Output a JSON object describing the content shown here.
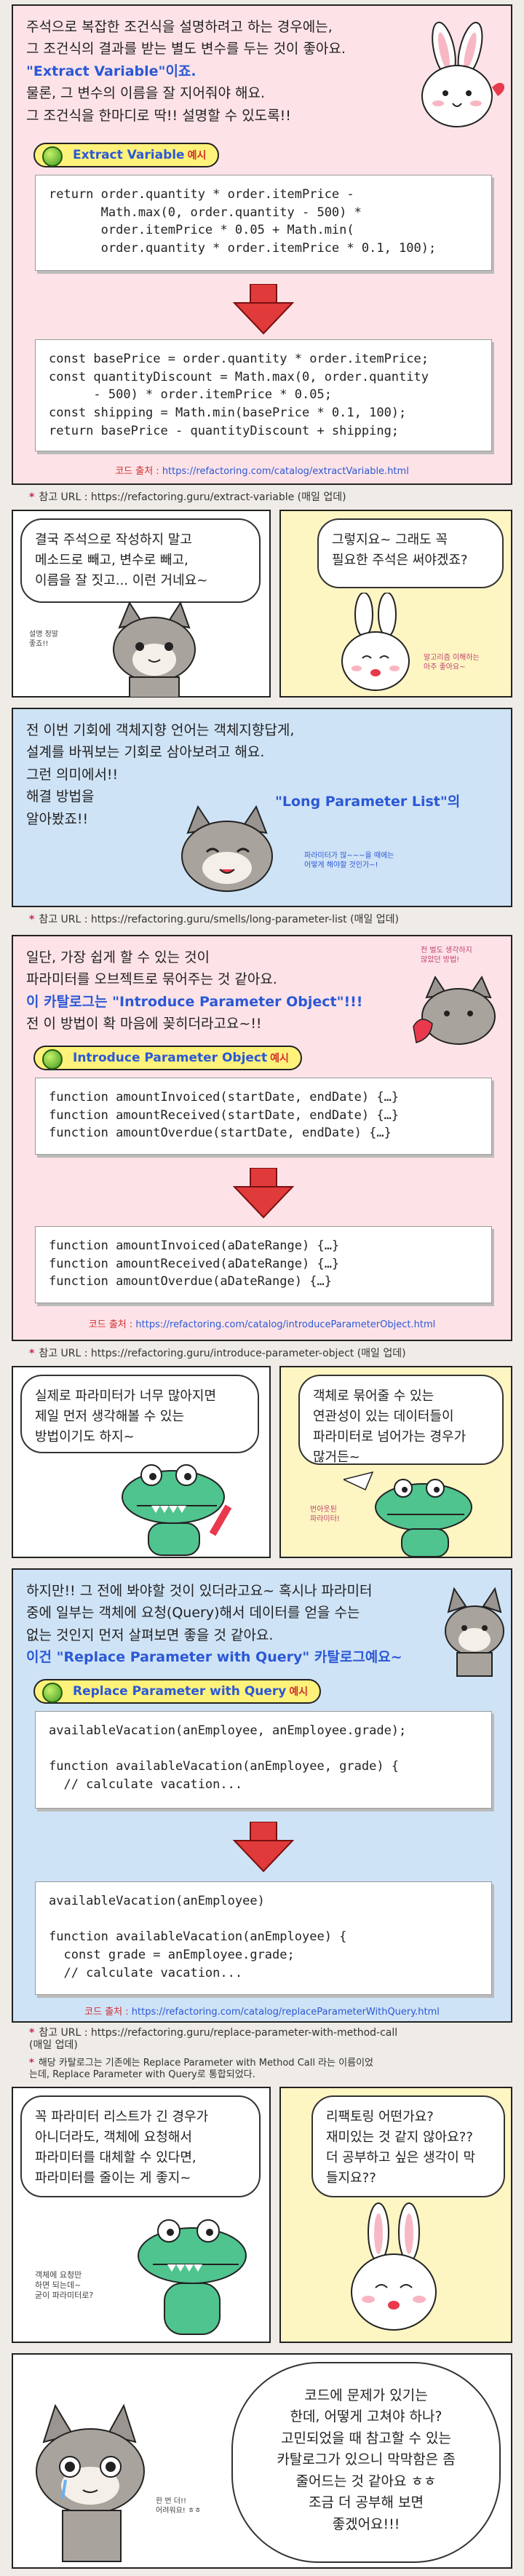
{
  "panel1": {
    "intro": [
      "주석으로 복잡한 조건식을 설명하려고 하는 경우에는,",
      "그 조건식의 결과를 받는 별도 변수를 두는 것이 좋아요.",
      "\"Extract Variable\"이죠.",
      "물론, 그 변수의 이름을 잘 지어줘야 해요.",
      "그 조건식을 한마디로 딱!! 설명할 수 있도록!!"
    ],
    "pill": "Extract Variable",
    "pill_suffix": "예시",
    "before_code": "return order.quantity * order.itemPrice -\n       Math.max(0, order.quantity - 500) *\n       order.itemPrice * 0.05 + Math.min(\n       order.quantity * order.itemPrice * 0.1, 100);",
    "after_code": "const basePrice = order.quantity * order.itemPrice;\nconst quantityDiscount = Math.max(0, order.quantity\n      - 500) * order.itemPrice * 0.05;\nconst shipping = Math.min(basePrice * 0.1, 100);\nreturn basePrice - quantityDiscount + shipping;",
    "source_label": "코드 출처 : ",
    "source_url": "https://refactoring.com/catalog/extractVariable.html"
  },
  "ref1": "참고 URL : https://refactoring.guru/extract-variable (매일 업데)",
  "panel2": {
    "left_bubble": "결국 주석으로 작성하지 말고\n메소드로 빼고, 변수로 빼고,\n이름을 잘 짓고... 이런 거네요~",
    "left_small": "설명 정말\n좋죠!!",
    "right_bubble": "그렇지요~ 그래도 꼭\n필요한 주석은 써야겠죠?",
    "right_small": "알고리즘 이해하는\n아주 좋아요~"
  },
  "panel3": {
    "lines": [
      "전 이번 기회에 객체지향 언어는 객체지향답게,",
      "설계를 바꿔보는 기회로 삼아보려고 해요.",
      "그런 의미에서!!",
      "해결 방법을",
      "알아봤죠!!"
    ],
    "highlight": "\"Long Parameter List\"의",
    "small": "파라미터가 많~~~을 때에는\n어떻게 해야할 것인가~!"
  },
  "ref2": "참고 URL : https://refactoring.guru/smells/long-parameter-list (매일 업데)",
  "panel4": {
    "lines": [
      "일단, 가장 쉽게 할 수 있는 것이",
      "파라미터를 오브젝트로 묶어주는 것 같아요.",
      "이 카탈로그는 \"Introduce Parameter Object\"!!!",
      "전 이 방법이 확 마음에 꽂히더라고요~!!"
    ],
    "small": "전 벌도 생각하지\n않았던 방법!",
    "pill": "Introduce Parameter Object",
    "pill_suffix": "예시",
    "before_code": "function amountInvoiced(startDate, endDate) {…}\nfunction amountReceived(startDate, endDate) {…}\nfunction amountOverdue(startDate, endDate) {…}",
    "after_code": "function amountInvoiced(aDateRange) {…}\nfunction amountReceived(aDateRange) {…}\nfunction amountOverdue(aDateRange) {…}",
    "source_label": "코드 출처 : ",
    "source_url": "https://refactoring.com/catalog/introduceParameterObject.html"
  },
  "ref3": "참고 URL : https://refactoring.guru/introduce-parameter-object (매일 업데)",
  "panel5": {
    "left_bubble": "실제로 파라미터가 너무 많아지면\n제일 먼저 생각해볼 수 있는\n방법이기도 하지~",
    "right_bubble": "객체로 묶어줄 수 있는\n연관성이 있는 데이터들이\n파라미터로 넘어가는 경우가\n많거든~",
    "right_small": "번아웃된\n파라미터!"
  },
  "panel6": {
    "lines": [
      "하지만!! 그 전에 봐야할 것이 있더라고요~ 혹시나 파라미터",
      "중에 일부는 객체에 요청(Query)해서 데이터를 얻을 수는",
      "없는 것인지 먼저 살펴보면 좋을 것 같아요.",
      "이건 \"Replace Parameter with Query\" 카탈로그예요~"
    ],
    "pill": "Replace Parameter with Query",
    "pill_suffix": "예시",
    "before_code": "availableVacation(anEmployee, anEmployee.grade);\n\nfunction availableVacation(anEmployee, grade) {\n  // calculate vacation...",
    "after_code": "availableVacation(anEmployee)\n\nfunction availableVacation(anEmployee) {\n  const grade = anEmployee.grade;\n  // calculate vacation...",
    "source_label": "코드 출처 : ",
    "source_url": "https://refactoring.com/catalog/replaceParameterWithQuery.html"
  },
  "ref4": "참고 URL : https://refactoring.guru/replace-parameter-with-method-call\n(매일 업데)",
  "ref5": "해당 카탈로그는 기존에는 Replace Parameter with Method Call 라는 이름이었\n는데, Replace Parameter with Query로 통합되었다.",
  "panel7": {
    "left_bubble": "꼭 파라미터 리스트가 긴 경우가\n아니더라도, 객체에 요청해서\n파라미터를 대체할 수 있다면,\n파라미터를 줄이는 게 좋지~",
    "left_small": "객체에 요청만\n하면 되는데~\n굳이 파라미터로?",
    "right_bubble": "리팩토링 어떤가요?\n재미있는 것 같지 않아요??\n더 공부하고 싶은 생각이 막\n들지요??"
  },
  "panel8": {
    "bubble": "코드에 문제가 있기는\n한데, 어떻게 고쳐야 하나?\n고민되었을 때 참고할 수 있는\n카탈로그가 있으니 막막함은 좀\n줄어드는 것 같아요 ㅎㅎ\n조금 더 공부해 보면\n좋겠어요!!!",
    "small": "한 번 더!!\n어려워요! ㅎㅎ"
  },
  "colors": {
    "accent": "#2b58d6",
    "red_arrow": "#e03a3a",
    "pill": "#fff27a"
  }
}
